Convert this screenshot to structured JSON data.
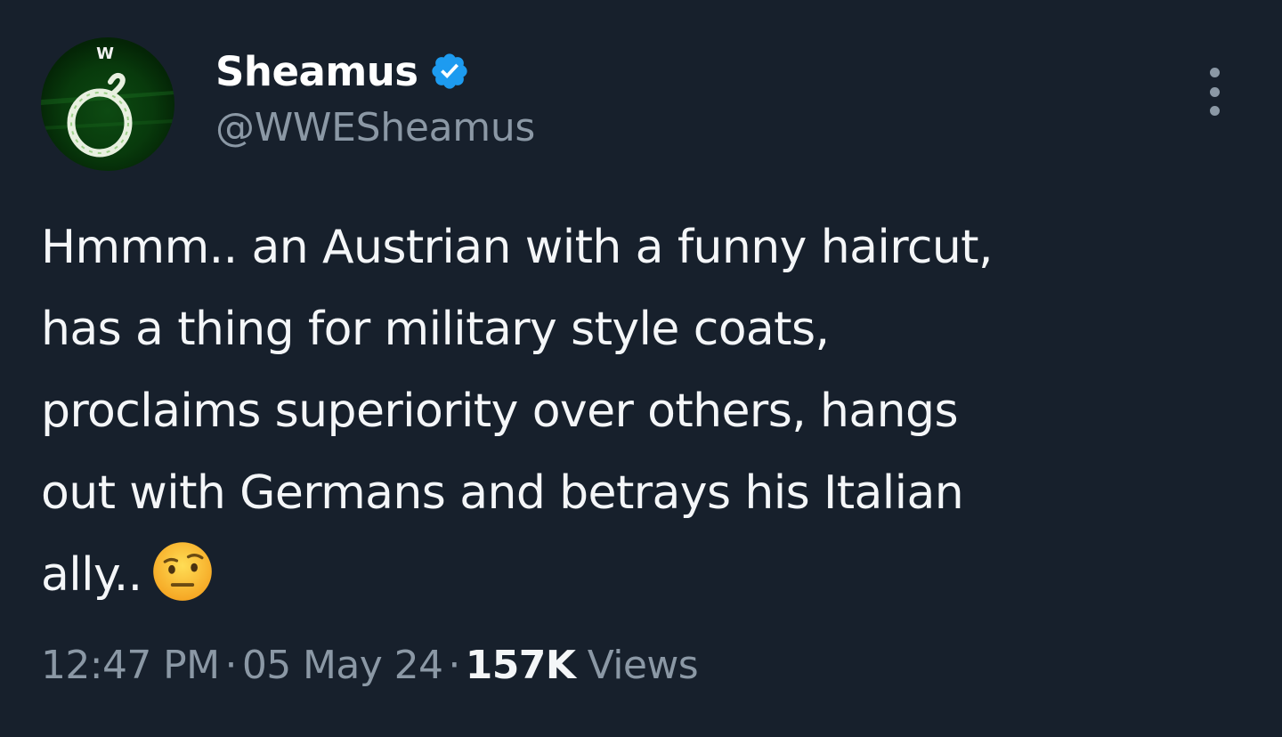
{
  "author": {
    "display_name": "Sheamus",
    "handle": "@WWESheamus",
    "avatar_badge_text": "W"
  },
  "tweet": {
    "lines": [
      "Hmmm.. an Austrian with a funny haircut,",
      "has a thing for military style coats,",
      "proclaims superiority over others, hangs",
      "out with Germans and betrays his Italian",
      "ally.."
    ],
    "emoji": "raised-eyebrow-face"
  },
  "meta": {
    "time": "12:47 PM",
    "separator": "·",
    "date": "05 May 24",
    "views_count": "157K",
    "views_label": "Views"
  },
  "icons": {
    "verified": "verified-badge-icon",
    "more": "more-options-icon"
  },
  "colors": {
    "background": "#17202c",
    "text": "#f4f6f8",
    "secondary_text": "#8b98a5",
    "verified_blue": "#1d9bf0"
  }
}
